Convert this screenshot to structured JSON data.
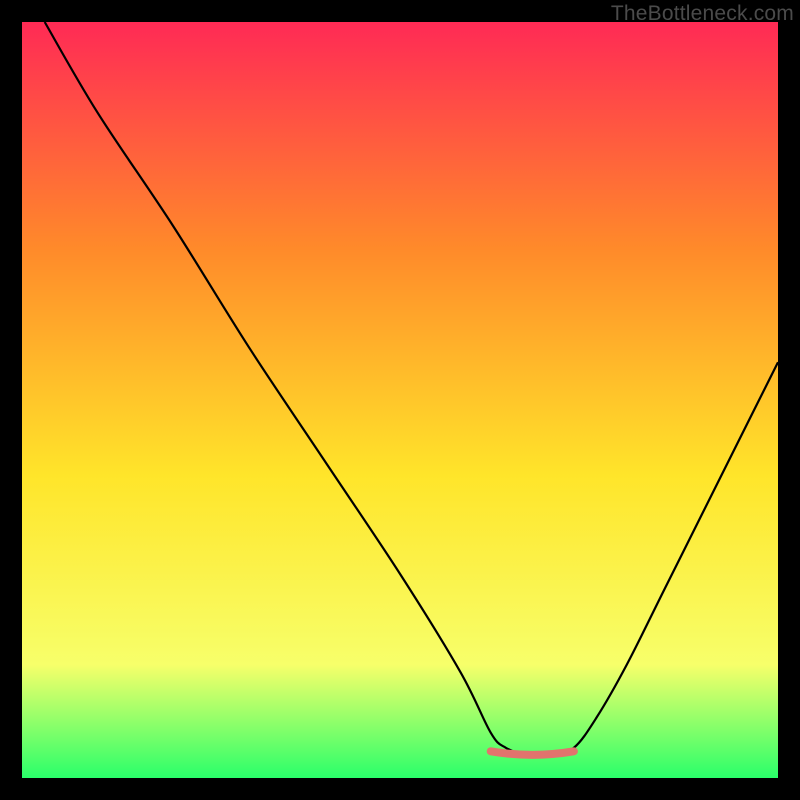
{
  "watermark": "TheBottleneck.com",
  "chart_data": {
    "type": "line",
    "title": "",
    "xlabel": "",
    "ylabel": "",
    "xlim": [
      0,
      100
    ],
    "ylim": [
      0,
      100
    ],
    "grid": false,
    "legend": false,
    "background_gradient": {
      "top": "#ff2a55",
      "upper_mid": "#ff8a2a",
      "mid": "#ffe52a",
      "lower_mid": "#f7ff6a",
      "bottom": "#2aff6a"
    },
    "curve_color": "#000000",
    "valley_segment": {
      "color": "#e2736d",
      "x_start": 62,
      "x_end": 73,
      "y": 3,
      "width": 8
    },
    "series": [
      {
        "name": "bottleneck-curve",
        "x": [
          3,
          10,
          20,
          30,
          40,
          50,
          58,
          62,
          64,
          67,
          70,
          73,
          76,
          80,
          85,
          90,
          95,
          100
        ],
        "y": [
          100,
          88,
          73,
          57,
          42,
          27,
          14,
          6,
          4,
          3,
          3,
          4,
          8,
          15,
          25,
          35,
          45,
          55
        ]
      }
    ]
  }
}
